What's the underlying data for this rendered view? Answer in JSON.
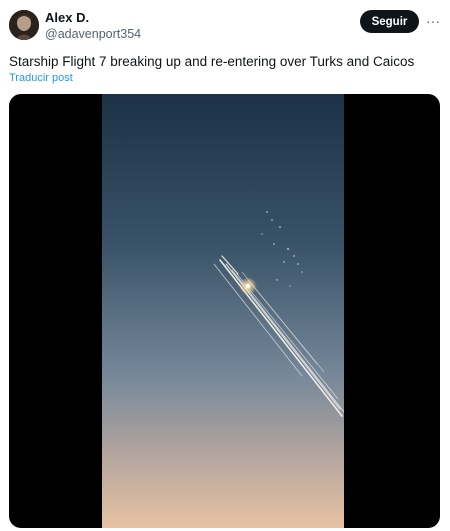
{
  "author": {
    "display_name": "Alex D.",
    "handle": "@adavenport354"
  },
  "actions": {
    "follow_label": "Seguir",
    "more_label": "···"
  },
  "tweet": {
    "text": "Starship Flight 7 breaking up and re-entering over Turks and Caicos",
    "translate_label": "Traducir post"
  },
  "colors": {
    "link": "#1d9bf0",
    "button_bg": "#0f1419",
    "secondary_text": "#536471",
    "sky_top": "#1e3448",
    "sky_bottom": "#e7c4a4"
  },
  "icons": {
    "more": "more-horizontal-icon",
    "avatar": "user-avatar"
  }
}
